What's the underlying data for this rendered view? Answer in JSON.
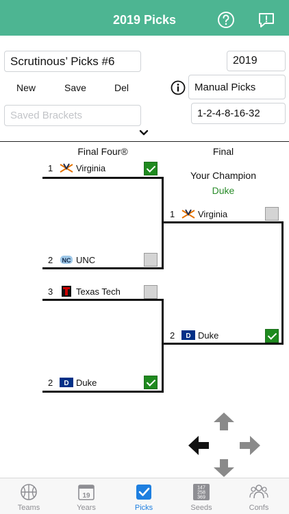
{
  "header": {
    "title": "2019 Picks"
  },
  "controls": {
    "bracket_name": "Scrutinous’ Picks #6",
    "year": "2019",
    "new_label": "New",
    "save_label": "Save",
    "del_label": "Del",
    "mode": "Manual Picks",
    "scoring": "1-2-4-8-16-32",
    "saved_placeholder": "Saved Brackets"
  },
  "bracket": {
    "final_four_title": "Final Four®",
    "final_title": "Final",
    "champion_label": "Your Champion",
    "champion_name": "Duke",
    "final_four": [
      {
        "seed": "1",
        "name": "Virginia",
        "logo": "virginia-logo",
        "checked": true
      },
      {
        "seed": "2",
        "name": "UNC",
        "logo": "unc-logo",
        "checked": false
      },
      {
        "seed": "3",
        "name": "Texas Tech",
        "logo": "texas-tech-logo",
        "checked": false
      },
      {
        "seed": "2",
        "name": "Duke",
        "logo": "duke-logo",
        "checked": true
      }
    ],
    "final": [
      {
        "seed": "1",
        "name": "Virginia",
        "logo": "virginia-logo",
        "checked": false
      },
      {
        "seed": "2",
        "name": "Duke",
        "logo": "duke-logo",
        "checked": true
      }
    ]
  },
  "tabs": [
    {
      "label": "Teams",
      "icon": "basketball-icon",
      "active": false
    },
    {
      "label": "Years",
      "icon": "calendar-icon",
      "active": false,
      "badge": "19"
    },
    {
      "label": "Picks",
      "icon": "checkbox-icon",
      "active": true
    },
    {
      "label": "Seeds",
      "icon": "seed-grid-icon",
      "active": false,
      "grid": [
        "147",
        "258",
        "369"
      ]
    },
    {
      "label": "Confs",
      "icon": "people-icon",
      "active": false
    }
  ],
  "colors": {
    "header": "#4db592",
    "check_green": "#1f8a1f",
    "champion_green": "#2a8c2a",
    "tab_active": "#1e7fe0"
  }
}
